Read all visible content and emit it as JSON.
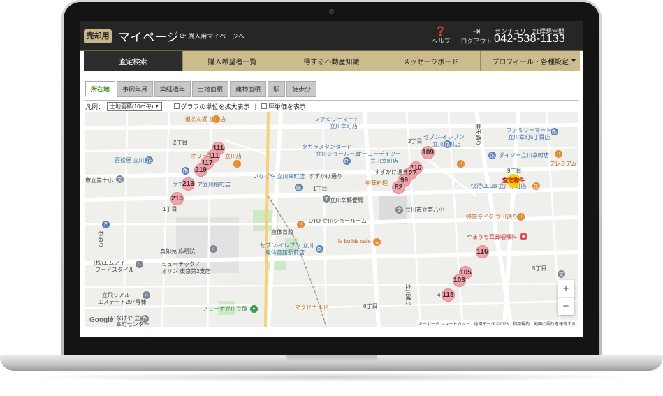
{
  "header": {
    "badge": "売却用",
    "title": "マイページ",
    "switch_link": "購入用マイページへ",
    "help": "ヘルプ",
    "logout": "ログアウト",
    "company": "センチュリー21理想空間",
    "phone": "042-538-1133"
  },
  "nav": {
    "tabs": [
      {
        "label": "査定検索",
        "active": true
      },
      {
        "label": "購入希望者一覧"
      },
      {
        "label": "得する不動産知識"
      },
      {
        "label": "メッセージボード"
      },
      {
        "label": "プロフィール・各種設定"
      }
    ]
  },
  "subtabs": [
    "所在地",
    "事例年月",
    "築経過年",
    "土地面積",
    "建物面積",
    "駅",
    "徒歩分"
  ],
  "legend": {
    "label": "凡例：",
    "select": "土地面積(10㎡毎)",
    "cb1": "グラフの単位を拡大表示",
    "cb2": "坪単価を表示"
  },
  "map": {
    "labels": {
      "l1": "道とん堀 立川店",
      "l2": "2丁目",
      "l3": "オリー",
      "l4": "立川店",
      "l5": "西松屋 立川店",
      "l6": "市立第十小",
      "l7": "ウエ",
      "l8": "ア立川柏町店",
      "l9": "1丁目",
      "l10": "ファミリーマート",
      "l11": "立川幸町店",
      "l12": "タカラスタンダード",
      "l13": "立川ショールーム",
      "l14": "ケーヨーデイツー",
      "l15": "立川幸町店",
      "l16": "いなげや 立川幸町店",
      "l17": "すずかけ通り",
      "l18": "すずかけ通り",
      "l19": "1丁目",
      "l20": "中華料理",
      "l21": "立川幸郵便局",
      "l22": "立川市立第八小",
      "l23": "セブン-イレブン",
      "l24": "立川幸町店",
      "l25": "ファミリーマート",
      "l26": "立川幸町5丁目店",
      "l27": "ダイソー立川幸町店",
      "l28": "プレミアム",
      "l29": "快活CLUB 立川幸町店",
      "l30": "焼肉ライク 立川通り店",
      "l31": "やまうち耳鼻咽喉科",
      "l32": "泉体育館",
      "l33": "TOTO 立川ショールーム",
      "l34": "セブン-イレブン 立川",
      "l35": "泉体育館駅前店",
      "l36": "le builds cafe",
      "l37": "真如苑 応現院",
      "l38": "(株)エムアイ",
      "l39": "フードスタイル",
      "l40": "ヒューテックノ",
      "l41": "オリン 東京第2支店",
      "l42": "立飛リアル",
      "l43": "エステート207号棟",
      "l44": "アリーナ立川立飛",
      "l45": "マクドナルド",
      "l46": "6丁目",
      "l47": "いなげや 立川",
      "l48": "幸町センター",
      "l49": "5丁目",
      "l50": "4丁目",
      "l51": "井天通り",
      "l52": "9丁目",
      "l53": "2丁目",
      "l54": "杉通り",
      "l55": "立川通り"
    },
    "target_label": "査定物件",
    "pins": [
      "111",
      "111",
      "117",
      "219",
      "213",
      "213",
      "109",
      "110",
      "127",
      "99",
      "82",
      "116",
      "105",
      "103",
      "118"
    ],
    "zoom_in": "+",
    "zoom_out": "−",
    "google": "Google",
    "attribution": "キーボード ショートカット　地図データ ©2023　利用規約　地図の誤りを報告する"
  },
  "colors": {
    "header_bg": "#262626",
    "nav_gold": "#cbbb8d",
    "pin": "#f0a2ab",
    "target": "#f8d000"
  }
}
